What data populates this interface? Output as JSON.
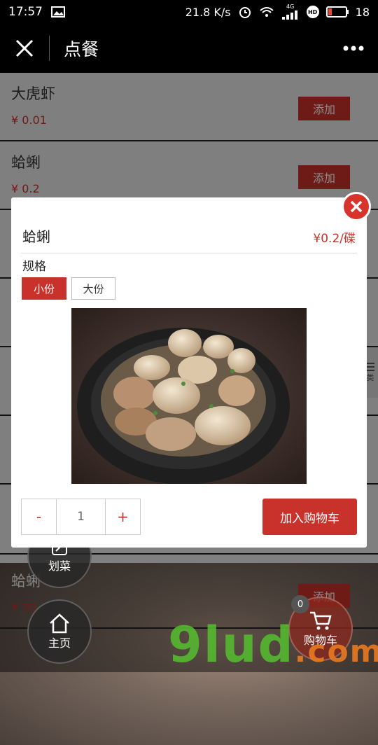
{
  "status_bar": {
    "time": "17:57",
    "network_speed": "21.8 K/s",
    "signal_label": "4G",
    "hd_label": "HD",
    "battery": "18"
  },
  "navbar": {
    "title": "点餐"
  },
  "menu_items": [
    {
      "name": "大虎虾",
      "price": "¥ 0.01",
      "add_label": "添加"
    },
    {
      "name": "蛤蜊",
      "price": "¥ 0.2",
      "add_label": "添加"
    },
    {
      "name": "蛤蜊",
      "price": "¥ 30",
      "add_label": "添加"
    }
  ],
  "side_tab": {
    "label": "类"
  },
  "floating": {
    "dish_label": "划菜",
    "home_label": "主页",
    "cart_label": "购物车",
    "cart_count": "0"
  },
  "watermark": {
    "text": "9lud",
    "suffix": ".com"
  },
  "modal": {
    "dish_name": "蛤蜊",
    "price": "¥0.2/碟",
    "spec_label": "规格",
    "spec_options": [
      "小份",
      "大份"
    ],
    "selected_spec": "小份",
    "minus_label": "-",
    "quantity": "1",
    "plus_label": "+",
    "add_to_cart_label": "加入购物车"
  },
  "colors": {
    "accent": "#c8322a",
    "navbar": "#000000"
  }
}
